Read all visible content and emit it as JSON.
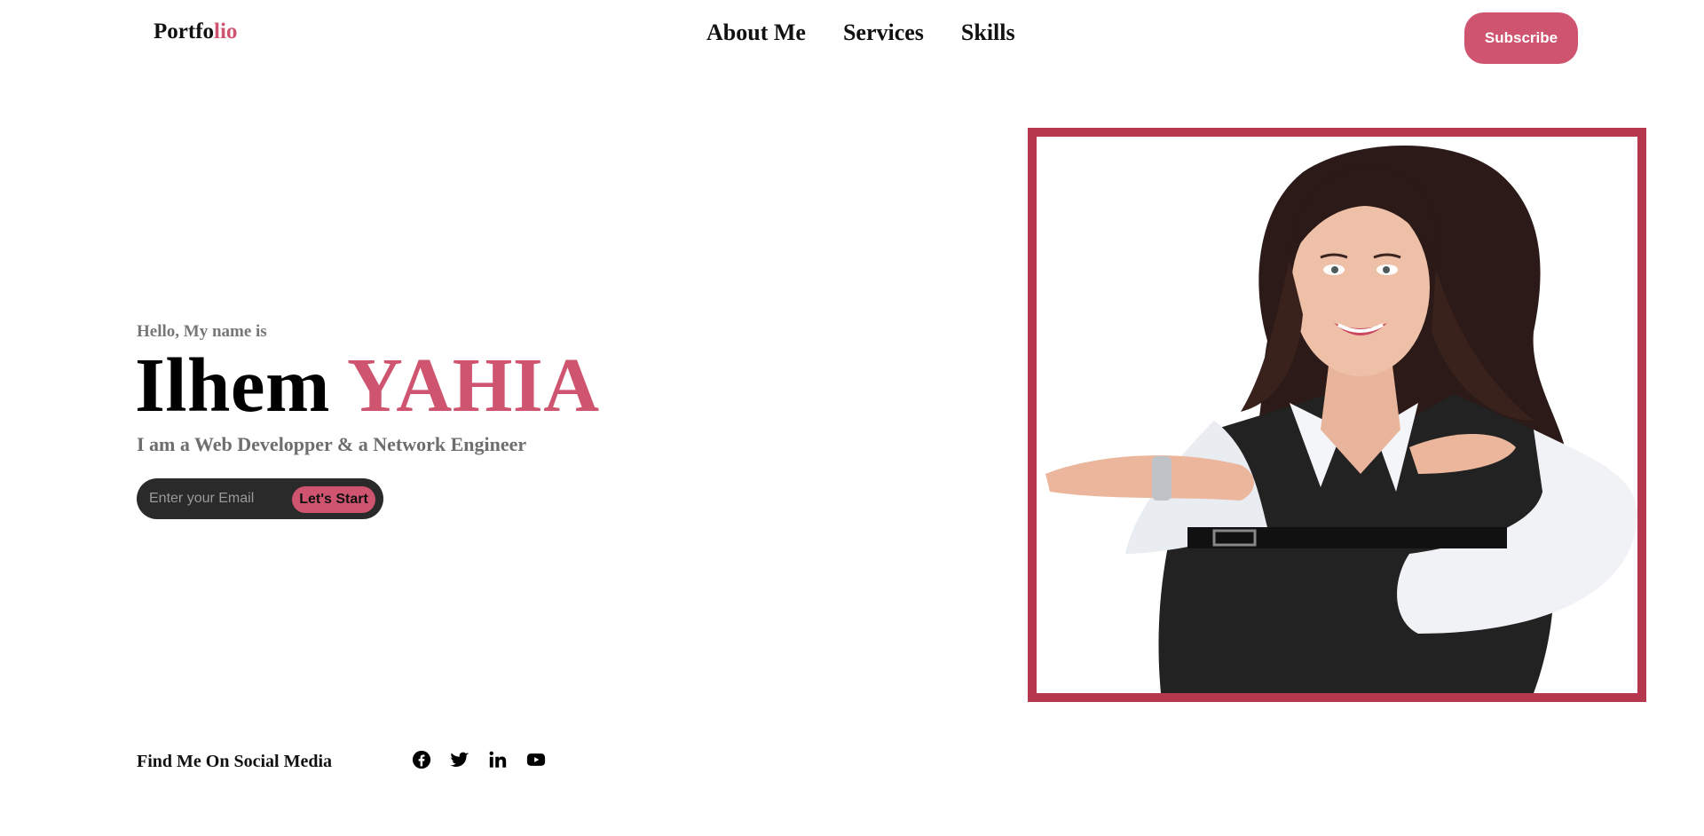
{
  "header": {
    "logo_main": "Portfo",
    "logo_accent": "lio",
    "nav": [
      "About Me",
      "Services",
      "Skills"
    ],
    "subscribe_label": "Subscribe"
  },
  "hero": {
    "greeting": "Hello, My name is",
    "first_name": "Ilhem",
    "last_name": "YAHIA",
    "tagline": "I am a Web Developper & a Network Engineer",
    "email_placeholder": "Enter your Email",
    "cta_label": "Let's Start"
  },
  "social": {
    "label": "Find Me On Social Media",
    "icons": [
      "facebook-icon",
      "twitter-icon",
      "linkedin-icon",
      "youtube-icon"
    ]
  },
  "colors": {
    "accent": "#cf5470",
    "frame": "#b6384f",
    "input_bg": "#2a2a2a"
  }
}
